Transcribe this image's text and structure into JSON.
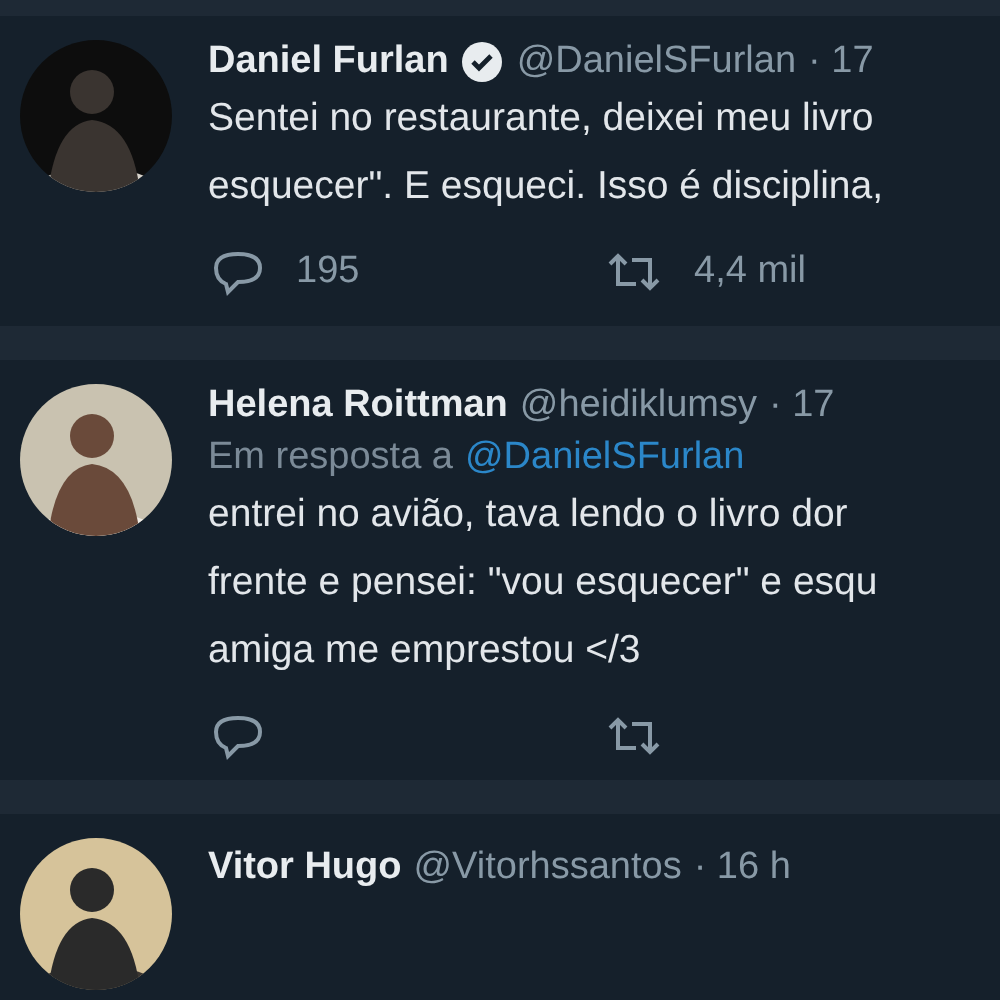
{
  "tweets": [
    {
      "name": "Daniel Furlan",
      "verified": true,
      "handle": "@DanielSFurlan",
      "time": "· 17",
      "lines": [
        "Sentei no restaurante, deixei meu livro",
        "esquecer\". E esqueci. Isso é disciplina,"
      ],
      "actions": [
        {
          "kind": "reply",
          "count": "195"
        },
        {
          "kind": "retweet",
          "count": "4,4 mil"
        }
      ]
    },
    {
      "name": "Helena Roittman",
      "verified": false,
      "handle": "@heidiklumsy",
      "time": "· 17",
      "reply_to": {
        "prefix": "Em resposta a",
        "handle": "@DanielSFurlan"
      },
      "lines": [
        "entrei no avião, tava lendo o livro dor",
        "frente e pensei: \"vou esquecer\" e esqu",
        "amiga me emprestou </3"
      ],
      "actions": [
        {
          "kind": "reply"
        },
        {
          "kind": "retweet"
        }
      ]
    },
    {
      "name": "Vitor Hugo",
      "verified": false,
      "handle": "@Vitorhssantos",
      "time": "· 16 h"
    }
  ]
}
